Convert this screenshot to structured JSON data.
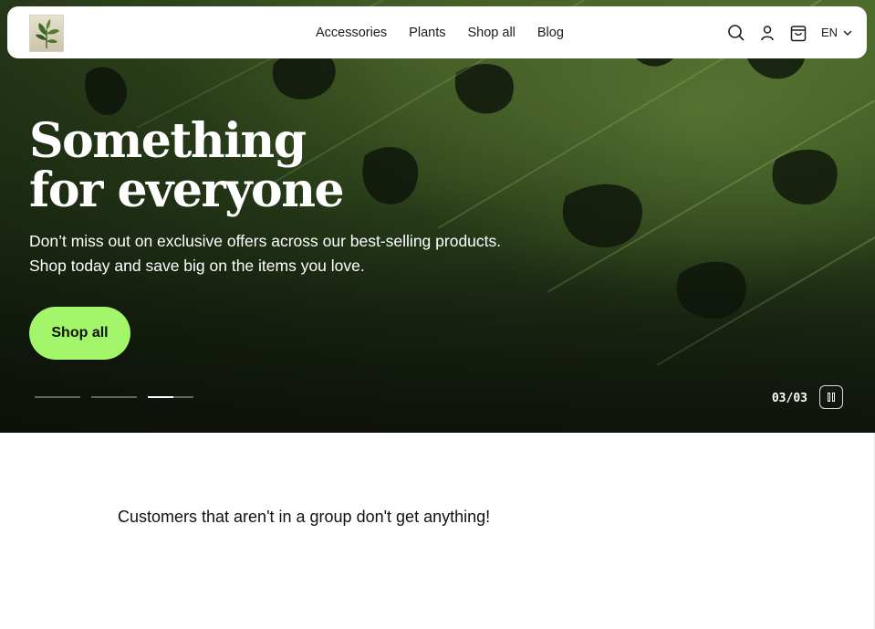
{
  "header": {
    "logo_alt": "Store logo",
    "nav": [
      {
        "label": "Accessories"
      },
      {
        "label": "Plants"
      },
      {
        "label": "Shop all"
      },
      {
        "label": "Blog"
      }
    ],
    "icons": [
      "search-icon",
      "account-icon",
      "cart-icon"
    ],
    "language": "EN"
  },
  "hero": {
    "headline_line1": "Something",
    "headline_line2": "for everyone",
    "subtext": "Don’t miss out on exclusive offers across our best-selling products. Shop today and save big on the items you love.",
    "cta_label": "Shop all",
    "cta_color": "#a3f56a",
    "slides_total": 3,
    "current_slide": 3,
    "current_slide_progress": 0.55,
    "counter": "03/03"
  },
  "promo": {
    "message": "Customers that aren't in a group don't get anything!"
  }
}
